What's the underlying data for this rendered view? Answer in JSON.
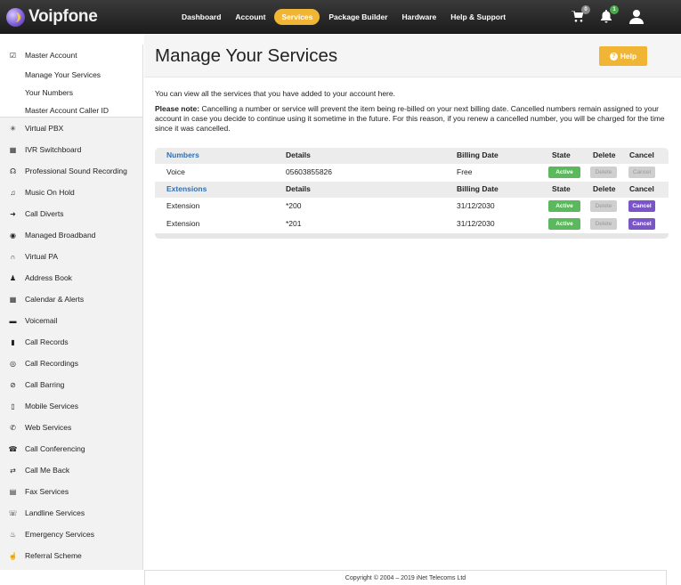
{
  "brand": {
    "name": "Voipfone"
  },
  "nav": {
    "items": [
      {
        "label": "Dashboard",
        "active": false
      },
      {
        "label": "Account",
        "active": false
      },
      {
        "label": "Services",
        "active": true
      },
      {
        "label": "Package Builder",
        "active": false
      },
      {
        "label": "Hardware",
        "active": false
      },
      {
        "label": "Help & Support",
        "active": false
      }
    ],
    "cart_count": "0",
    "notification_count": "1"
  },
  "sidebar": {
    "master": {
      "label": "Master Account",
      "subitems": [
        "Manage Your Services",
        "Your Numbers",
        "Master Account Caller ID"
      ]
    },
    "items": [
      {
        "label": "Virtual PBX",
        "icon": "asterisk-icon"
      },
      {
        "label": "IVR Switchboard",
        "icon": "grid-icon"
      },
      {
        "label": "Professional Sound Recording",
        "icon": "headset-icon"
      },
      {
        "label": "Music On Hold",
        "icon": "music-icon"
      },
      {
        "label": "Call Diverts",
        "icon": "arrow-right-icon"
      },
      {
        "label": "Managed Broadband",
        "icon": "globe-icon"
      },
      {
        "label": "Virtual PA",
        "icon": "headphones-icon"
      },
      {
        "label": "Address Book",
        "icon": "user-icon"
      },
      {
        "label": "Calendar & Alerts",
        "icon": "calendar-icon"
      },
      {
        "label": "Voicemail",
        "icon": "comment-icon"
      },
      {
        "label": "Call Records",
        "icon": "bar-chart-icon"
      },
      {
        "label": "Call Recordings",
        "icon": "record-icon"
      },
      {
        "label": "Call Barring",
        "icon": "ban-icon"
      },
      {
        "label": "Mobile Services",
        "icon": "mobile-icon"
      },
      {
        "label": "Web Services",
        "icon": "phone-icon"
      },
      {
        "label": "Call Conferencing",
        "icon": "conference-icon"
      },
      {
        "label": "Call Me Back",
        "icon": "retweet-icon"
      },
      {
        "label": "Fax Services",
        "icon": "print-icon"
      },
      {
        "label": "Landline Services",
        "icon": "landline-icon"
      },
      {
        "label": "Emergency Services",
        "icon": "fire-icon"
      },
      {
        "label": "Referral Scheme",
        "icon": "thumbs-up-icon"
      }
    ]
  },
  "page": {
    "title": "Manage Your Services",
    "help_label": "Help",
    "intro": "You can view all the services that you have added to your account here.",
    "note_label": "Please note:",
    "note_text": " Cancelling a number or service will prevent the item being re-billed on your next billing date. Cancelled numbers remain assigned to your account in case you decide to continue using it sometime in the future. For this reason, if you renew a cancelled number, you will be charged for the time since it was cancelled."
  },
  "table": {
    "columns": {
      "details": "Details",
      "billing": "Billing Date",
      "state": "State",
      "delete": "Delete",
      "cancel": "Cancel"
    },
    "sections": [
      {
        "title": "Numbers",
        "rows": [
          {
            "type": "Voice",
            "details": "05603855826",
            "billing": "Free",
            "state": "Active",
            "delete": "Delete",
            "cancel": "Cancel",
            "cancel_enabled": false
          }
        ]
      },
      {
        "title": "Extensions",
        "rows": [
          {
            "type": "Extension",
            "details": "*200",
            "billing": "31/12/2030",
            "state": "Active",
            "delete": "Delete",
            "cancel": "Cancel",
            "cancel_enabled": true
          },
          {
            "type": "Extension",
            "details": "*201",
            "billing": "31/12/2030",
            "state": "Active",
            "delete": "Delete",
            "cancel": "Cancel",
            "cancel_enabled": true
          }
        ]
      }
    ]
  },
  "footer": {
    "copyright": "Copyright © 2004 – 2019 iNet Telecoms Ltd"
  },
  "colors": {
    "accent": "#f0b535",
    "active": "#5cb85c",
    "cancel": "#7a55c8",
    "link": "#2f6fb3"
  }
}
